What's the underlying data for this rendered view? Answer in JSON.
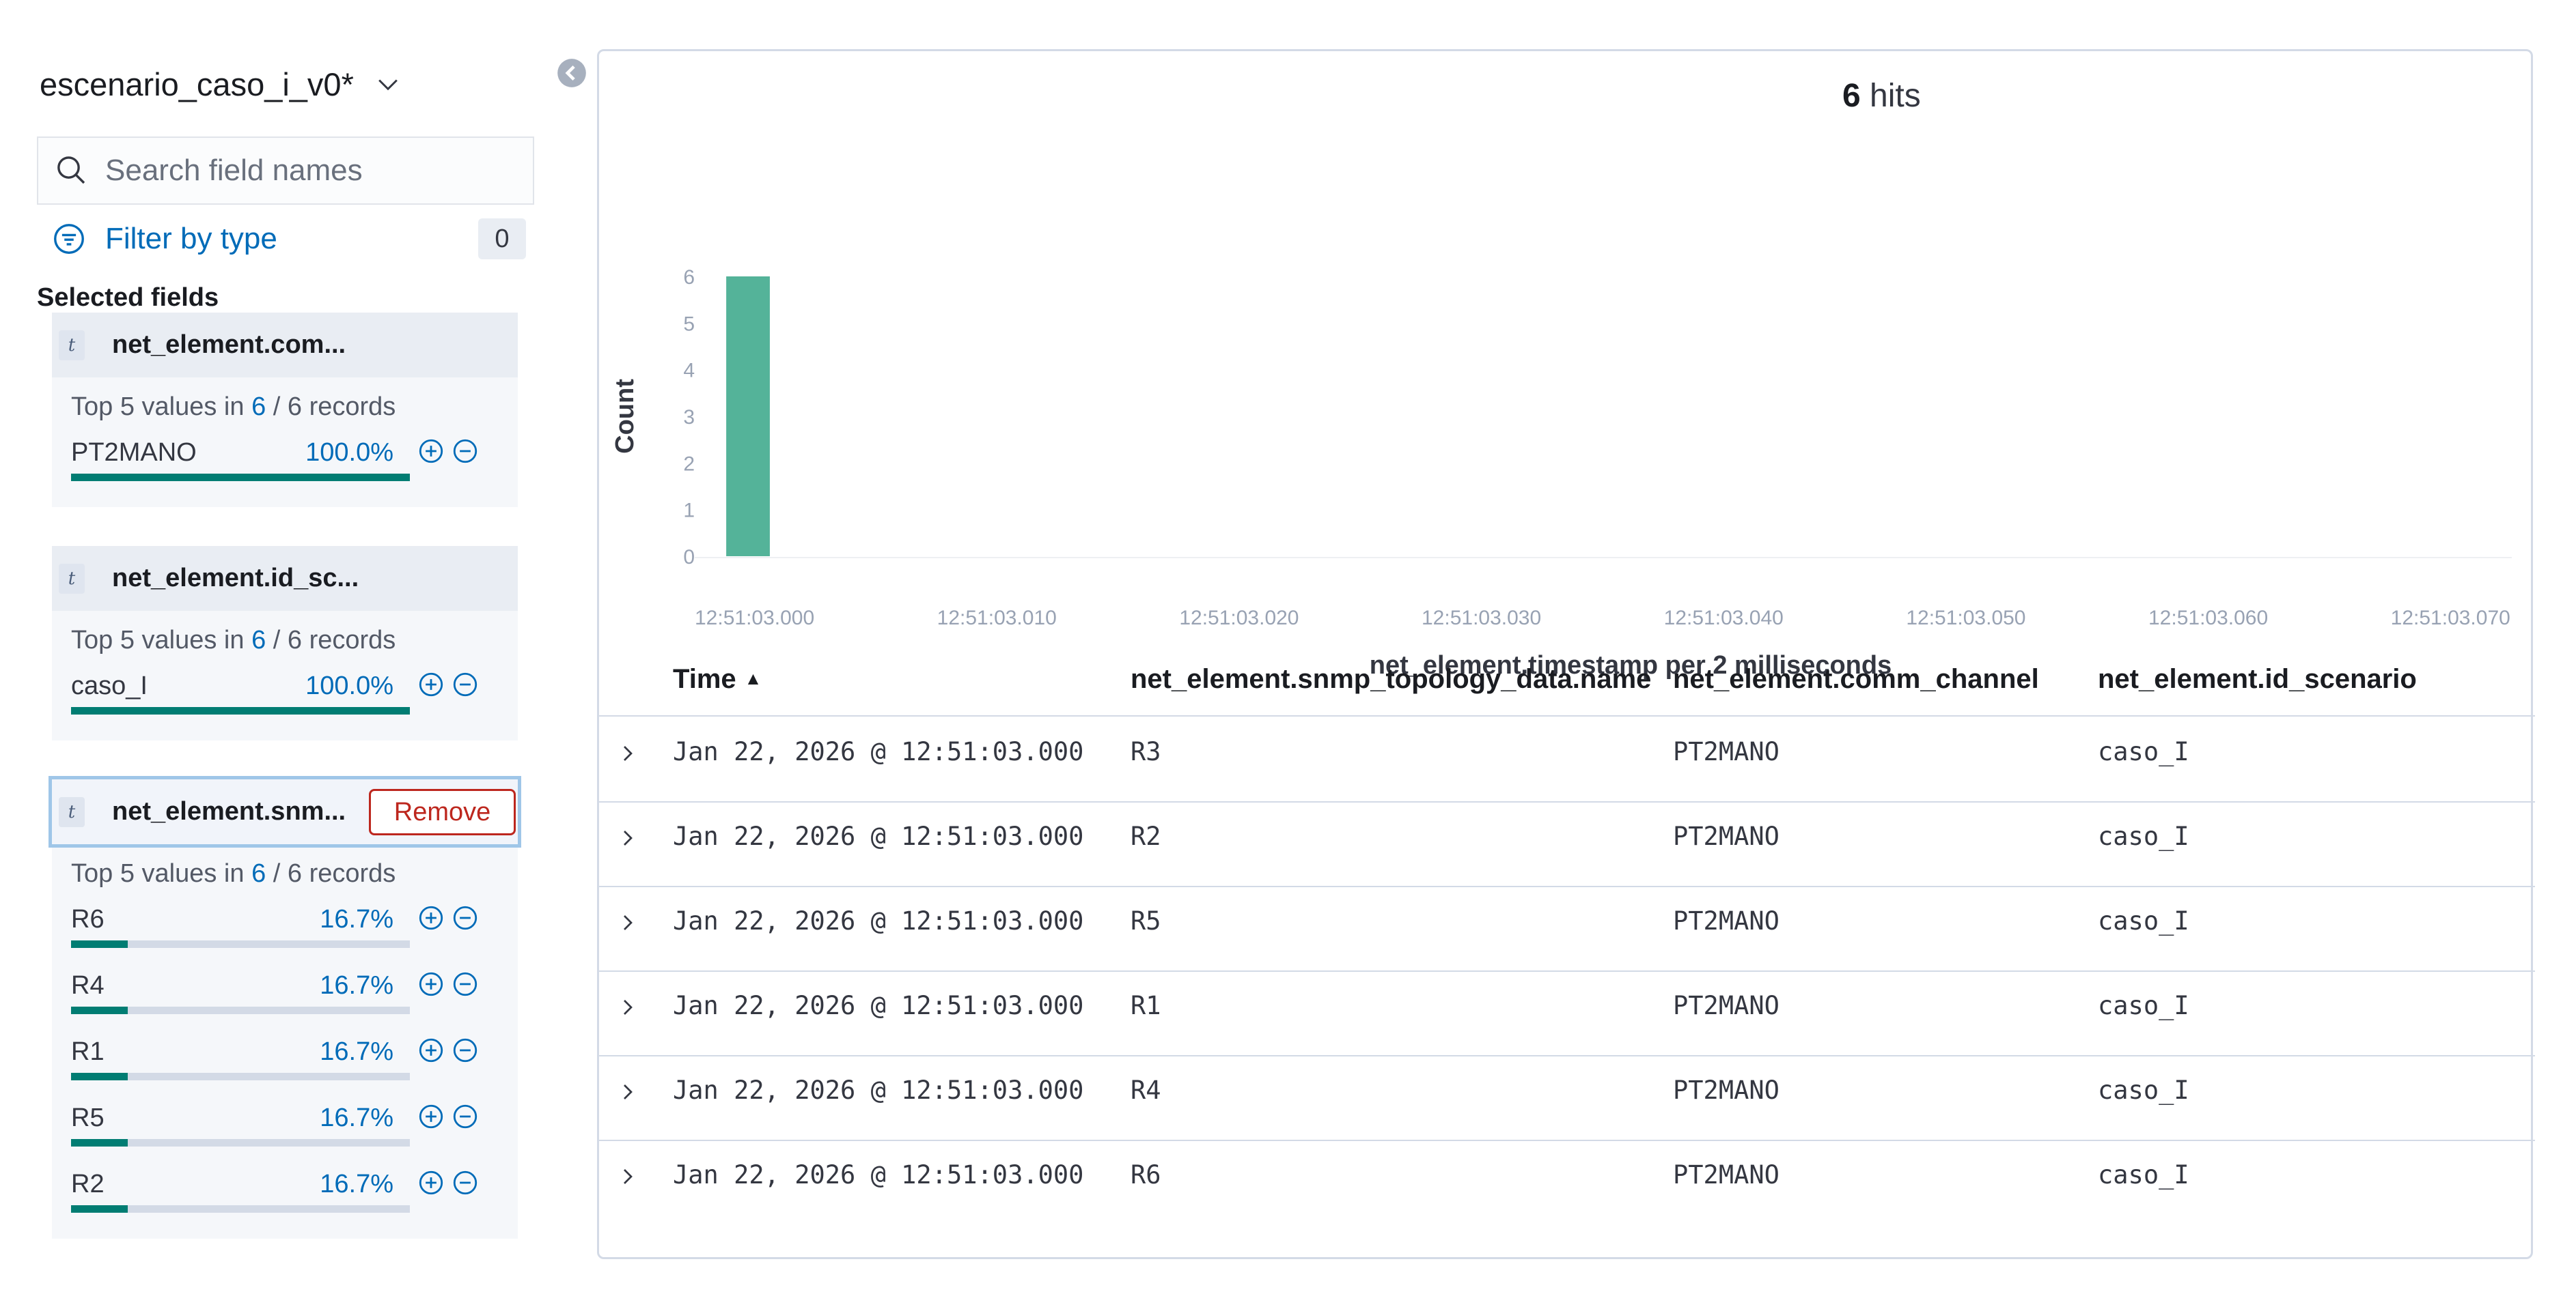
{
  "index_pattern": "escenario_caso_i_v0*",
  "search": {
    "placeholder": "Search field names"
  },
  "filter": {
    "label": "Filter by type",
    "count": "0"
  },
  "selected_fields_title": "Selected fields",
  "fields": [
    {
      "name": "net_element.com...",
      "type_token": "t",
      "top5_prefix": "Top 5 values in ",
      "top5_count": "6",
      "top5_sep": " / ",
      "top5_total": "6",
      "top5_suffix": " records",
      "values": [
        {
          "label": "PT2MANO",
          "percent_text": "100.0%",
          "fraction": 1.0
        }
      ]
    },
    {
      "name": "net_element.id_sc...",
      "type_token": "t",
      "top5_prefix": "Top 5 values in ",
      "top5_count": "6",
      "top5_sep": " / ",
      "top5_total": "6",
      "top5_suffix": " records",
      "values": [
        {
          "label": "caso_I",
          "percent_text": "100.0%",
          "fraction": 1.0
        }
      ]
    },
    {
      "name": "net_element.snm...",
      "type_token": "t",
      "remove_label": "Remove",
      "top5_prefix": "Top 5 values in ",
      "top5_count": "6",
      "top5_sep": " / ",
      "top5_total": "6",
      "top5_suffix": " records",
      "values": [
        {
          "label": "R6",
          "percent_text": "16.7%",
          "fraction": 0.167
        },
        {
          "label": "R4",
          "percent_text": "16.7%",
          "fraction": 0.167
        },
        {
          "label": "R1",
          "percent_text": "16.7%",
          "fraction": 0.167
        },
        {
          "label": "R5",
          "percent_text": "16.7%",
          "fraction": 0.167
        },
        {
          "label": "R2",
          "percent_text": "16.7%",
          "fraction": 0.167
        }
      ]
    }
  ],
  "hits": {
    "count": "6",
    "label": "hits"
  },
  "chart_data": {
    "type": "bar",
    "ylabel": "Count",
    "xlabel": "net_element.timestamp per 2 milliseconds",
    "y_ticks": [
      "0",
      "1",
      "2",
      "3",
      "4",
      "5",
      "6"
    ],
    "ylim": [
      0,
      6
    ],
    "x_ticks": [
      "12:51:03.000",
      "12:51:03.010",
      "12:51:03.020",
      "12:51:03.030",
      "12:51:03.040",
      "12:51:03.050",
      "12:51:03.060",
      "12:51:03.070"
    ],
    "x_range_ms": [
      0,
      75
    ],
    "bars": [
      {
        "x_ms": 0,
        "width_ms": 2,
        "value": 6
      }
    ],
    "bar_color": "#54b399"
  },
  "table": {
    "columns": [
      "Time",
      "net_element.snmp_topology_data.name",
      "net_element.comm_channel",
      "net_element.id_scenario"
    ],
    "rows": [
      {
        "time": "Jan 22, 2026 @ 12:51:03.000",
        "name": "R3",
        "channel": "PT2MANO",
        "scenario": "caso_I"
      },
      {
        "time": "Jan 22, 2026 @ 12:51:03.000",
        "name": "R2",
        "channel": "PT2MANO",
        "scenario": "caso_I"
      },
      {
        "time": "Jan 22, 2026 @ 12:51:03.000",
        "name": "R5",
        "channel": "PT2MANO",
        "scenario": "caso_I"
      },
      {
        "time": "Jan 22, 2026 @ 12:51:03.000",
        "name": "R1",
        "channel": "PT2MANO",
        "scenario": "caso_I"
      },
      {
        "time": "Jan 22, 2026 @ 12:51:03.000",
        "name": "R4",
        "channel": "PT2MANO",
        "scenario": "caso_I"
      },
      {
        "time": "Jan 22, 2026 @ 12:51:03.000",
        "name": "R6",
        "channel": "PT2MANO",
        "scenario": "caso_I"
      }
    ]
  }
}
